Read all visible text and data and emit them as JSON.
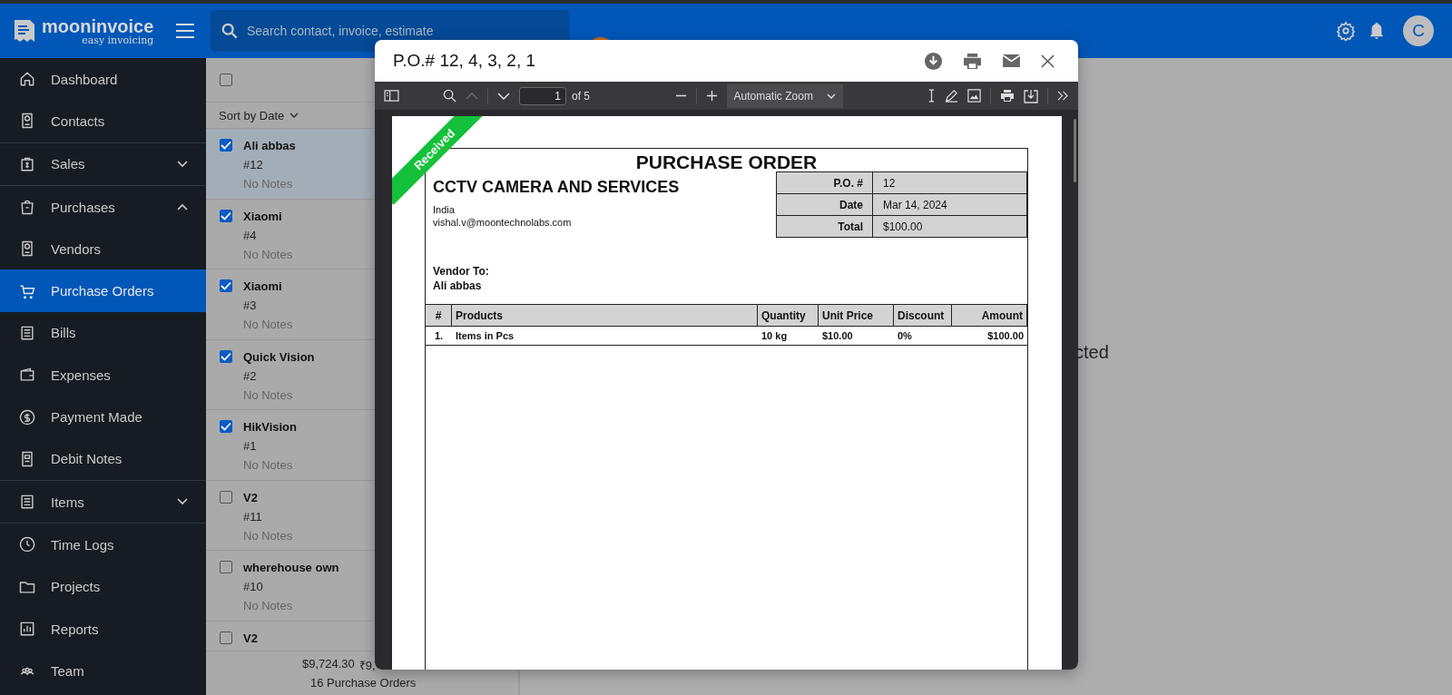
{
  "header": {
    "logo_name": "mooninvoice",
    "logo_tagline": "easy invoicing",
    "search": {
      "placeholder": "Search contact, invoice, estimate"
    },
    "avatar": "C"
  },
  "sidebar": {
    "groups": [
      [
        {
          "label": "Dashboard",
          "selected": false
        },
        {
          "label": "Contacts",
          "selected": false
        }
      ],
      [
        {
          "label": "Sales",
          "selected": false,
          "expanded": false
        }
      ],
      [
        {
          "label": "Purchases",
          "selected": false,
          "expanded": true
        },
        {
          "label": "Vendors",
          "selected": false
        },
        {
          "label": "Purchase Orders",
          "selected": true
        },
        {
          "label": "Bills",
          "selected": false
        },
        {
          "label": "Expenses",
          "selected": false
        },
        {
          "label": "Payment Made",
          "selected": false
        },
        {
          "label": "Debit Notes",
          "selected": false
        }
      ],
      [
        {
          "label": "Items",
          "selected": false,
          "expanded": false
        }
      ],
      [
        {
          "label": "Time Logs",
          "selected": false
        },
        {
          "label": "Projects",
          "selected": false
        },
        {
          "label": "Reports",
          "selected": false
        },
        {
          "label": "Team",
          "selected": false
        }
      ]
    ]
  },
  "list": {
    "select_all": {
      "checked": false
    },
    "sort": "Sort by Date",
    "rows": [
      {
        "name": "Ali abbas",
        "number": "#12",
        "notes": "No Notes",
        "checked": true,
        "selected": true
      },
      {
        "name": "Xiaomi",
        "number": "#4",
        "notes": "No Notes",
        "checked": true,
        "selected": false
      },
      {
        "name": "Xiaomi",
        "number": "#3",
        "notes": "No Notes",
        "checked": true,
        "selected": false
      },
      {
        "name": "Quick Vision",
        "number": "#2",
        "notes": "No Notes",
        "checked": true,
        "selected": false
      },
      {
        "name": "HikVision",
        "number": "#1",
        "notes": "No Notes",
        "checked": true,
        "selected": false
      },
      {
        "name": "V2",
        "number": "#11",
        "notes": "No Notes",
        "checked": false,
        "selected": false
      },
      {
        "name": "wherehouse own",
        "number": "#10",
        "notes": "No Notes",
        "checked": false,
        "selected": false
      },
      {
        "name": "V2",
        "checked": false,
        "selected": false
      }
    ],
    "footer": {
      "totals": [
        "$9,724.30",
        "₹9,"
      ],
      "count": "16 Purchase Orders"
    }
  },
  "detail": {
    "message": "cted"
  },
  "modal": {
    "title": "P.O.# 12, 4, 3, 2, 1",
    "viewer": {
      "prev": {
        "disabled": true
      },
      "next": {
        "disabled": false
      },
      "page": "1",
      "page_count": "of 5",
      "zoom": "Automatic Zoom"
    },
    "document": {
      "stamp": "Received",
      "title": "PURCHASE ORDER",
      "company": "CCTV CAMERA AND SERVICES",
      "address_lines": [
        "India",
        "vishal.v@moontechnolabs.com"
      ],
      "info": [
        {
          "label": "P.O. #",
          "value": "12"
        },
        {
          "label": "Date",
          "value": "Mar 14, 2024"
        },
        {
          "label": "Total",
          "value": "$100.00"
        }
      ],
      "vendor_label": "Vendor To:",
      "vendor": "Ali abbas",
      "columns": [
        "#",
        "Products",
        "Quantity",
        "Unit Price",
        "Discount",
        "Amount"
      ],
      "rows": [
        [
          "1.",
          "Items in Pcs",
          "10 kg",
          "$10.00",
          "0%",
          "$100.00"
        ]
      ]
    }
  }
}
